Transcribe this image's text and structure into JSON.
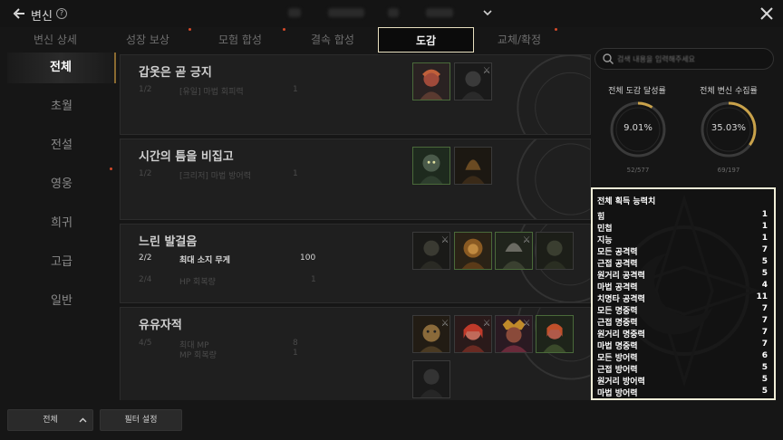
{
  "header": {
    "title": "변신",
    "help_icon": "?"
  },
  "tabs": [
    {
      "label": "변신 상세",
      "dot": false
    },
    {
      "label": "성장 보상",
      "dot": true
    },
    {
      "label": "모험 합성",
      "dot": true
    },
    {
      "label": "결속 합성",
      "dot": false
    },
    {
      "label": "도감",
      "dot": false,
      "active": true
    },
    {
      "label": "교체/확정",
      "dot": true
    }
  ],
  "sidebar": {
    "items": [
      {
        "label": "전체",
        "active": true
      },
      {
        "label": "초월"
      },
      {
        "label": "전설"
      },
      {
        "label": "영웅"
      },
      {
        "label": "희귀"
      },
      {
        "label": "고급"
      },
      {
        "label": "일반"
      }
    ]
  },
  "collections": [
    {
      "title": "갑옷은 곧 긍지",
      "rows": [
        {
          "count": "1/2",
          "name": "[유일] 마법 회피력",
          "value": "1",
          "state": "dim"
        }
      ]
    },
    {
      "title": "시간의 틈을 비집고",
      "rows": [
        {
          "count": "1/2",
          "name": "[크리저] 마법 방어력",
          "value": "1",
          "state": "dim"
        }
      ]
    },
    {
      "title": "느린 발걸음",
      "rows": [
        {
          "count": "2/2",
          "name": "최대 소지 무게",
          "value": "100",
          "state": "on"
        },
        {
          "count": "2/4",
          "name": "HP 회복량",
          "value": "1",
          "state": "dim"
        }
      ]
    },
    {
      "title": "유유자적",
      "rows": [
        {
          "count": "4/5",
          "name": "최대 MP",
          "value": "8",
          "state": "dim"
        },
        {
          "count": "",
          "name": "MP 회복량",
          "value": "1",
          "state": "dim"
        }
      ]
    }
  ],
  "search": {
    "placeholder": "검색 내용을 입력해주세요"
  },
  "stats": {
    "collection_label": "전체 도감 달성률",
    "collection_percent": "9.01%",
    "collection_percent_value": 9.01,
    "collection_count": "52/577",
    "transform_label": "전체 변신 수집률",
    "transform_percent": "35.03%",
    "transform_percent_value": 35.03,
    "transform_count": "69/197"
  },
  "abilities": {
    "title": "전체 획득 능력치",
    "rows": [
      {
        "name": "힘",
        "value": "1"
      },
      {
        "name": "민첩",
        "value": "1"
      },
      {
        "name": "지능",
        "value": "1"
      },
      {
        "name": "모든 공격력",
        "value": "7"
      },
      {
        "name": "근접 공격력",
        "value": "5"
      },
      {
        "name": "원거리 공격력",
        "value": "5"
      },
      {
        "name": "마법 공격력",
        "value": "4"
      },
      {
        "name": "치명타 공격력",
        "value": "11"
      },
      {
        "name": "모든 명중력",
        "value": "7"
      },
      {
        "name": "근접 명중력",
        "value": "7"
      },
      {
        "name": "원거리 명중력",
        "value": "7"
      },
      {
        "name": "마법 명중력",
        "value": "7"
      },
      {
        "name": "모든 방어력",
        "value": "6"
      },
      {
        "name": "근접 방어력",
        "value": "5"
      },
      {
        "name": "원거리 방어력",
        "value": "5"
      },
      {
        "name": "마법 방어력",
        "value": "5"
      }
    ]
  },
  "bottom": {
    "all_label": "전체",
    "filter_label": "필터 설정"
  },
  "colors": {
    "accent_gold": "#c9a24a",
    "tab_dot": "#d44a2a",
    "highlight_border": "#f2efd8"
  },
  "icons": [
    "back-arrow-icon",
    "help-icon",
    "chevron-down-icon",
    "close-icon",
    "search-icon",
    "chevron-up-icon"
  ]
}
